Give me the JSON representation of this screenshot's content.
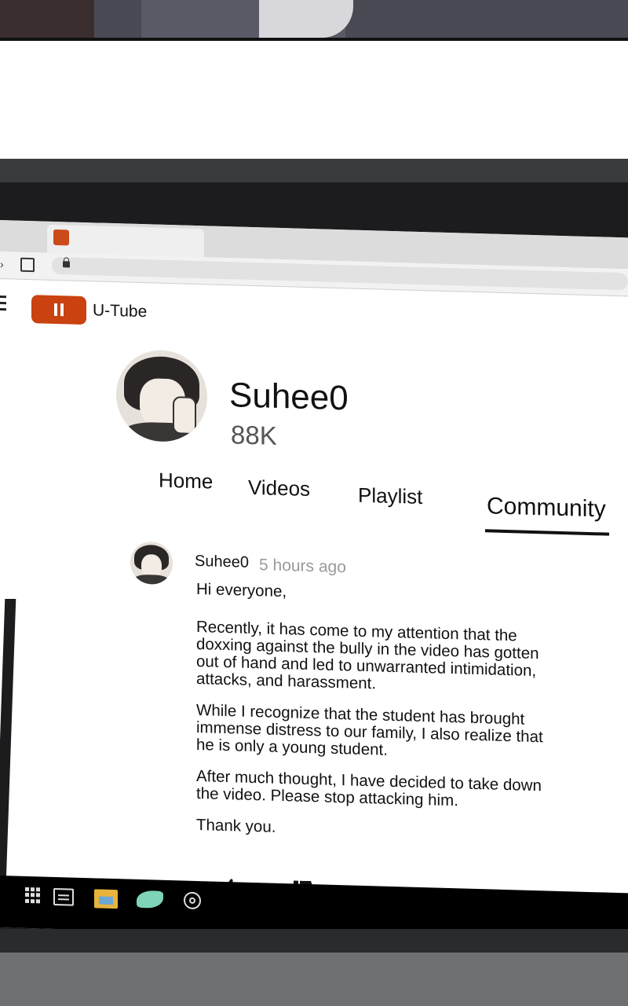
{
  "browser": {
    "tab_favicon_color": "#cc4a1a",
    "lock_icon": "lock-icon"
  },
  "header": {
    "brand": "U-Tube",
    "logo_color": "#c9420f"
  },
  "channel": {
    "name": "Suhee0",
    "subscribers": "88K"
  },
  "tabs": [
    {
      "label": "Home"
    },
    {
      "label": "Videos"
    },
    {
      "label": "Playlist"
    },
    {
      "label": "Community",
      "active": true
    }
  ],
  "post": {
    "author": "Suhee0",
    "time": "5 hours ago",
    "paragraphs": [
      "Hi everyone,",
      "Recently, it has come to my attention that the doxxing against the bully in the video has gotten out of hand and led to unwarranted intimidation, attacks, and harassment.",
      "While I recognize that the student has brought immense distress to our family, I also realize that he is only a young student.",
      "After much thought, I have decided to take down the video. Please stop attacking him.",
      "Thank you."
    ]
  },
  "taskbar": {
    "icons": [
      "start-grid-icon",
      "task-view-icon",
      "folder-icon",
      "leaf-app-icon",
      "browser-icon"
    ]
  }
}
